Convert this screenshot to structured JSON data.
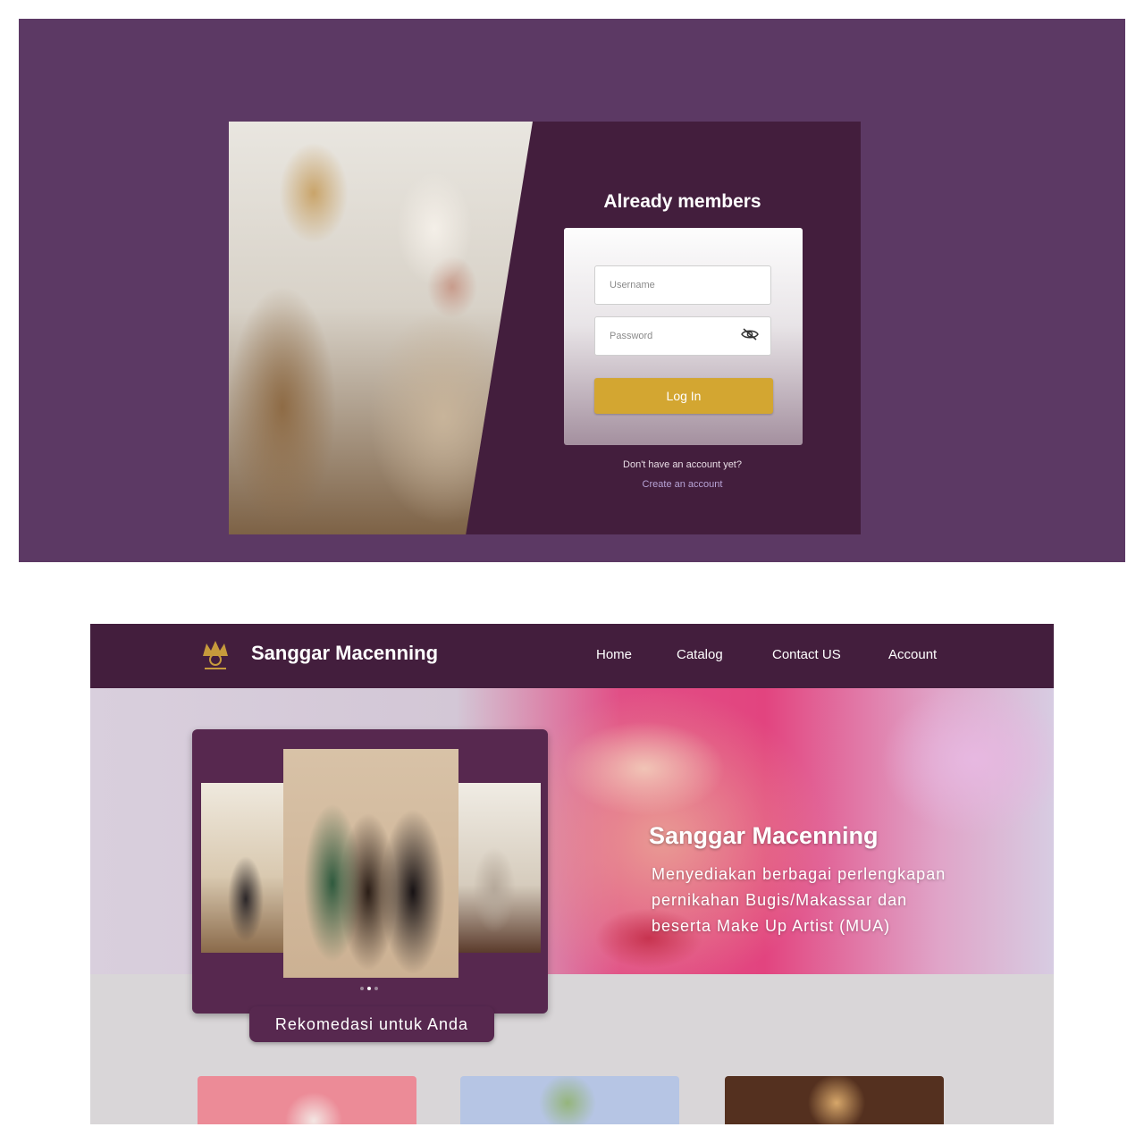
{
  "login": {
    "title": "Already members",
    "username_placeholder": "Username",
    "password_placeholder": "Password",
    "login_button": "Log In",
    "signup_question": "Don't have an account yet?",
    "signup_link": "Create an account",
    "colors": {
      "background": "#5c3964",
      "card": "#431e3d",
      "button": "#d3a631"
    }
  },
  "home": {
    "brand": "Sanggar Macenning",
    "nav": [
      "Home",
      "Catalog",
      "Contact US",
      "Account"
    ],
    "hero": {
      "title": "Sanggar Macenning",
      "description": "Menyediakan berbagai perlengkapan pernikahan Bugis/Makassar dan beserta Make Up Artist (MUA)"
    },
    "carousel": {
      "slide_count": 3,
      "active_slide": 2
    },
    "recommendation_label": "Rekomedasi untuk Anda",
    "colors": {
      "navbar": "#431e3d",
      "accent": "#57284f",
      "page": "#d9d6d8"
    }
  }
}
